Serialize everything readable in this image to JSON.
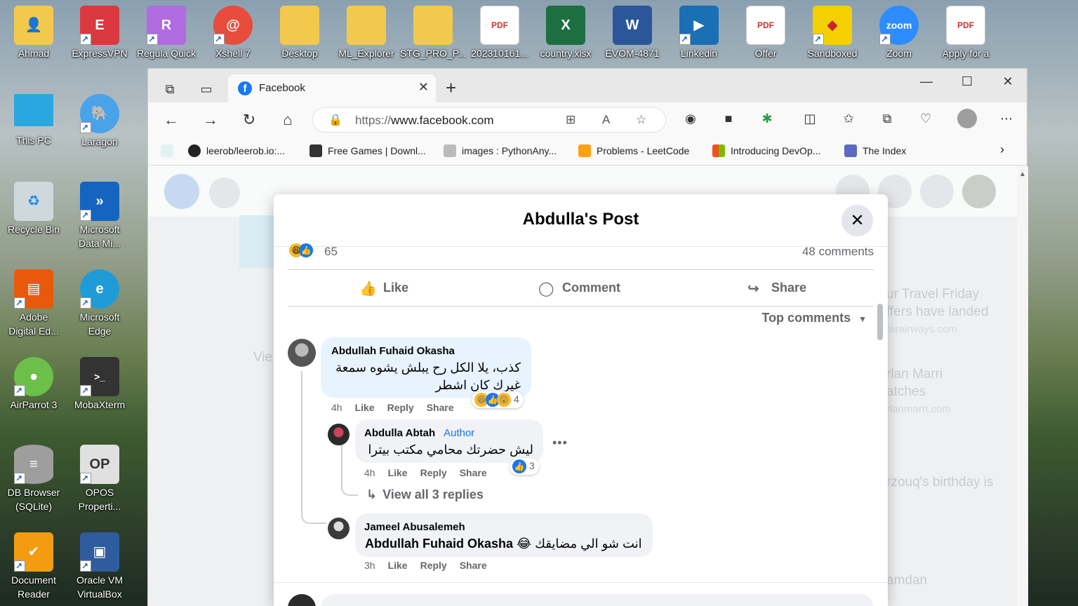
{
  "desktop": {
    "icons": [
      {
        "label": "Ahmad",
        "color": "#f2c94c"
      },
      {
        "label": "ExpressVPN",
        "color": "#da3940"
      },
      {
        "label": "Regula Quick",
        "color": "#b06be0"
      },
      {
        "label": "Xshell 7",
        "color": "#e74c3c"
      },
      {
        "label": "Desktop",
        "color": "#f2c94c"
      },
      {
        "label": "ML_Explorer",
        "color": "#f2c94c"
      },
      {
        "label": "STG_PRO_P...",
        "color": "#f2c94c"
      },
      {
        "label": "202310161...",
        "color": "#ffffff"
      },
      {
        "label": "country.xlsx",
        "color": "#1d6f42"
      },
      {
        "label": "EVOM-4871",
        "color": "#2b579a"
      },
      {
        "label": "Linkedin",
        "color": "#1b6fb5"
      },
      {
        "label": "Offer",
        "color": "#ffffff"
      },
      {
        "label": "Sandboxed",
        "color": "#f5d000"
      },
      {
        "label": "Zoom",
        "color": "#2d8cff"
      },
      {
        "label": "Apply for a",
        "color": "#ffffff"
      },
      {
        "label": "This PC",
        "color": "#2aa7e0"
      },
      {
        "label": "Laragon",
        "color": "#4aa3e8"
      },
      {
        "label": "Recycle Bin",
        "color": "#cfd8dc"
      },
      {
        "label": "Microsoft Data Mi...",
        "color": "#1565c0"
      },
      {
        "label": "Adobe Digital Ed...",
        "color": "#e8590c"
      },
      {
        "label": "Microsoft Edge",
        "color": "#1f9cd8"
      },
      {
        "label": "AirParrot 3",
        "color": "#6cc04a"
      },
      {
        "label": "MobaXterm",
        "color": "#333333"
      },
      {
        "label": "DB Browser (SQLite)",
        "color": "#9e9e9e"
      },
      {
        "label": "OPOS Properti...",
        "color": "#e0e0e0"
      },
      {
        "label": "Document Reader",
        "color": "#f39c12"
      },
      {
        "label": "Oracle VM VirtualBox",
        "color": "#2f5c9e"
      }
    ]
  },
  "browser": {
    "tab_title": "Facebook",
    "tab_close": "✕",
    "new_tab": "+",
    "window_controls": [
      "—",
      "☐",
      "✕"
    ],
    "url_prefix": "https://",
    "url_host": "www.facebook.com",
    "bookmarks": [
      {
        "label": "leerob/leerob.io:...",
        "icon": "github-icon"
      },
      {
        "label": "Free Games | Downl...",
        "icon": "epic-icon"
      },
      {
        "label": "images : PythonAny...",
        "icon": "python-icon"
      },
      {
        "label": "Problems - LeetCode",
        "icon": "leetcode-icon"
      },
      {
        "label": "Introducing DevOp...",
        "icon": "microsoft-icon"
      },
      {
        "label": "The Index",
        "icon": "index-icon"
      }
    ]
  },
  "background_page": {
    "right_texts": [
      "ur Travel Friday",
      "ffers have landed",
      "tarairways.com",
      "rlan Marri",
      "atches",
      "rlanmarri.com",
      "rzouq's birthday is",
      "amdan"
    ],
    "left_text": "Vie"
  },
  "modal": {
    "title": "Abdulla's Post",
    "close": "✕",
    "reaction_count": "65",
    "comments_count": "48 comments",
    "actions": {
      "like": "Like",
      "comment": "Comment",
      "share": "Share"
    },
    "sort_label": "Top comments",
    "comments": [
      {
        "name": "Abdullah Fuhaid Okasha",
        "text_line1": "كذب، يلا الكل رح يبلش يشوه سمعة",
        "text_line2": "غيرك كان اشطر",
        "time": "4h",
        "like": "Like",
        "reply": "Reply",
        "share": "Share",
        "reactions": "4"
      },
      {
        "name": "Abdulla Abtah",
        "badge": "Author",
        "text": "ليش حضرتك محامي مكتب بيترا",
        "time": "4h",
        "like": "Like",
        "reply": "Reply",
        "share": "Share",
        "reactions": "3",
        "more": "•••"
      },
      {
        "view_replies": "View all 3 replies"
      },
      {
        "name": "Jameel Abusalemeh",
        "mention": "Abdullah Fuhaid Okasha",
        "text": "انت شو الي مضايقك 😂",
        "time": "3h",
        "like": "Like",
        "reply": "Reply",
        "share": "Share"
      }
    ]
  }
}
